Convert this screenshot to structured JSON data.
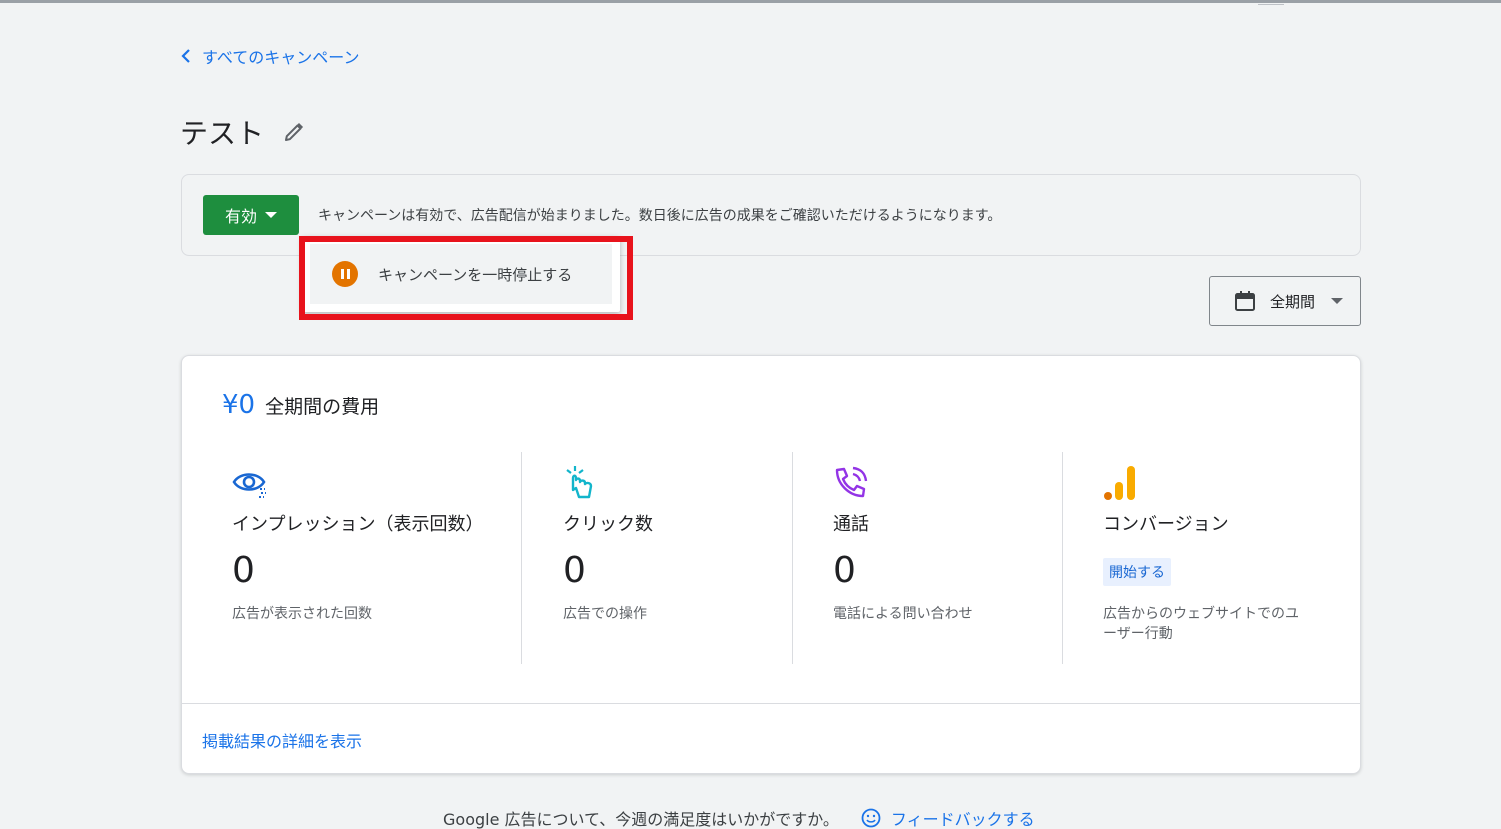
{
  "nav": {
    "back_label": "すべてのキャンペーン"
  },
  "campaign": {
    "title": "テスト"
  },
  "status": {
    "button_label": "有効",
    "message": "キャンペーンは有効で、広告配信が始まりました。数日後に広告の成果をご確認いただけるようになります。",
    "color": "#1e8e3e"
  },
  "dropdown": {
    "pause_label": "キャンペーンを一時停止する",
    "pause_color": "#e37400"
  },
  "highlight_color": "#e8131c",
  "date_range": {
    "label": "全期間"
  },
  "cost": {
    "value": "¥0",
    "label": "全期間の費用"
  },
  "metrics": [
    {
      "icon": "eye-icon",
      "label": "インプレッション（表示回数）",
      "value": "0",
      "desc": "広告が表示された回数"
    },
    {
      "icon": "click-icon",
      "label": "クリック数",
      "value": "0",
      "desc": "広告での操作"
    },
    {
      "icon": "phone-icon",
      "label": "通話",
      "value": "0",
      "desc": "電話による問い合わせ"
    },
    {
      "icon": "conversion-chart-icon",
      "label": "コンバージョン",
      "chip": "開始する",
      "desc": "広告からのウェブサイトでのユーザー行動"
    }
  ],
  "details_link": "掲載結果の詳細を表示",
  "feedback": {
    "question": "Google 広告について、今週の満足度はいかがですか。",
    "button_label": "フィードバックする"
  }
}
